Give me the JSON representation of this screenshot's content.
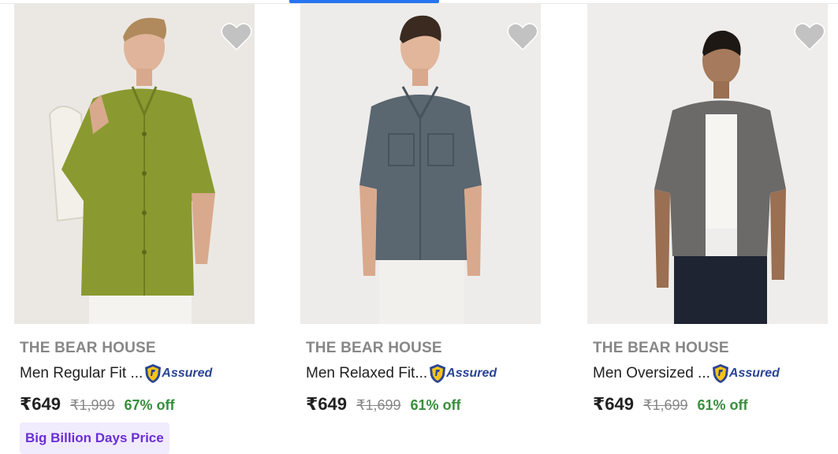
{
  "colors": {
    "accent": "#2874f0",
    "brand_text": "#878787",
    "discount": "#388e3c",
    "assured": "#2b4595",
    "badge_bg": "#f1ebfe",
    "badge_text": "#6b2fd6"
  },
  "products": [
    {
      "brand": "THE BEAR HOUSE",
      "title": "Men Regular Fit ...",
      "assured_label": "Assured",
      "price": "₹649",
      "mrp": "₹1,999",
      "discount": "67% off",
      "badge": "Big Billion Days Price",
      "shirt_color": "#8a9a30",
      "image_icon": "shirt-photo"
    },
    {
      "brand": "THE BEAR HOUSE",
      "title": "Men Relaxed Fit...",
      "assured_label": "Assured",
      "price": "₹649",
      "mrp": "₹1,699",
      "discount": "61% off",
      "shirt_color": "#5a6670",
      "image_icon": "shirt-photo"
    },
    {
      "brand": "THE BEAR HOUSE",
      "title": "Men Oversized ...",
      "assured_label": "Assured",
      "price": "₹649",
      "mrp": "₹1,699",
      "discount": "61% off",
      "shirt_color": "#6b6a68",
      "image_icon": "shirt-photo"
    }
  ]
}
